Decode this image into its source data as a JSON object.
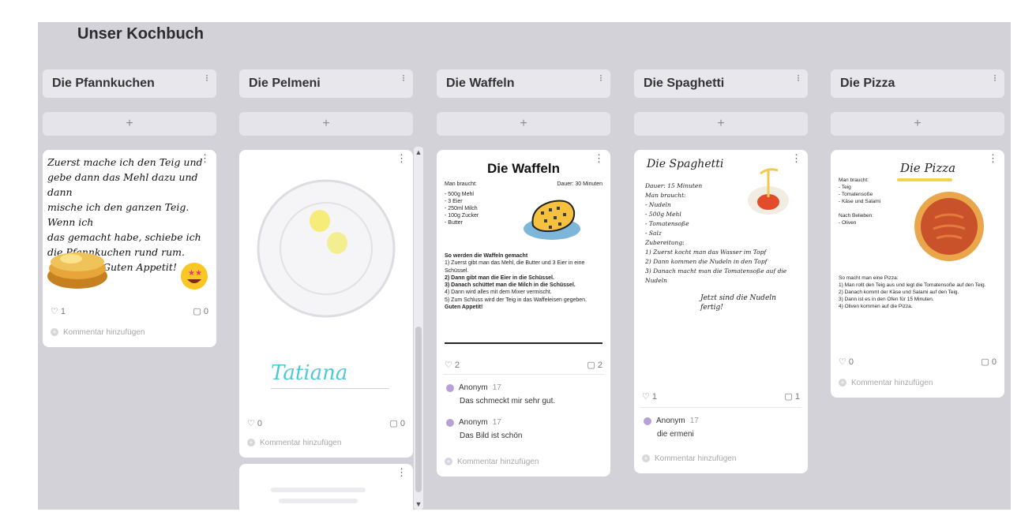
{
  "board": {
    "title": "Unser Kochbuch"
  },
  "columns": [
    {
      "title": "Die Pfannkuchen",
      "add": "+"
    },
    {
      "title": "Die Pelmeni",
      "add": "+"
    },
    {
      "title": "Die Waffeln",
      "add": "+"
    },
    {
      "title": "Die Spaghetti",
      "add": "+"
    },
    {
      "title": "Die Pizza",
      "add": "+"
    }
  ],
  "icons": {
    "menu": "vertical-dots-icon",
    "like": "heart-icon",
    "comment": "speech-bubble-icon",
    "add": "plus-icon"
  },
  "cards": {
    "pfannkuchen": {
      "note_lines": [
        "Zuerst mache ich den Teig und",
        "gebe dann das Mehl dazu und dann",
        "mische ich den ganzen Teig. Wenn ich",
        "das gemacht habe, schiebe ich",
        "die Pfannkuchen rund rum.",
        "Guten Appetit!"
      ],
      "likes": "1",
      "comments": "0",
      "add_comment": "Kommentar hinzufügen"
    },
    "pelmeni": {
      "signature": "Tatiana",
      "likes": "0",
      "comments": "0",
      "add_comment": "Kommentar hinzufügen"
    },
    "waffeln": {
      "title": "Die Waffeln",
      "left_head": "Man braucht:",
      "right_head": "Dauer: 30 Minuten",
      "ingredients": [
        "- 500g Mehl",
        "- 3 Eier",
        "- 250ml Milch",
        "- 100g Zucker",
        "- Butter"
      ],
      "steps_head": "So werden die Waffeln gemacht",
      "steps": [
        "1) Zuerst gibt man das Mehl, die Butter und 3 Eier in eine Schüssel.",
        "2) Dann gibt man die Eier in die Schüssel.",
        "3) Danach schüttet man die Milch in die Schüssel.",
        "4) Dann wird alles mit dem Mixer vermischt.",
        "5) Zum Schluss wird der Teig in das Waffeleisen gegeben.",
        "Guten Appetit!"
      ],
      "likes": "2",
      "comments": "2",
      "comment_list": [
        {
          "author": "Anonym",
          "time": "17",
          "text": "Das schmeckt mir sehr gut."
        },
        {
          "author": "Anonym",
          "time": "17",
          "text": "Das Bild ist schön"
        }
      ],
      "add_comment": "Kommentar hinzufügen"
    },
    "spaghetti": {
      "title": "Die Spaghetti",
      "lines": [
        "Dauer: 15 Minuten",
        "Man braucht:",
        "- Nudeln",
        "- 500g Mehl",
        "- Tomatensoße",
        "- Salz",
        "Zubereitung:",
        "1) Zuerst kocht man das Wasser im Topf",
        "2) Dann kommen die Nudeln in den Topf",
        "3) Danach macht man die Tomatensoße auf die Nudeln",
        "Jetzt sind die Nudeln fertig!"
      ],
      "likes": "1",
      "comments": "1",
      "comment_list": [
        {
          "author": "Anonym",
          "time": "17",
          "text": "die ermeni"
        }
      ],
      "add_comment": "Kommentar hinzufügen"
    },
    "pizza": {
      "title": "Die Pizza",
      "lines": [
        "Man braucht:",
        "- Teig",
        "- Tomatensoße",
        "- Käse und Salami",
        "",
        "Nach Belieben:",
        "- Oliven",
        "",
        "So macht man eine Pizza:",
        "1) Man rollt den Teig aus und legt die Tomatensoße auf den Teig.",
        "2) Danach kommt der Käse und Salami auf den Teig.",
        "3) Dann ist es in den Ofen für 15 Minuten.",
        "4) Oliven kommen auf die Pizza."
      ],
      "likes": "0",
      "comments": "0",
      "add_comment": "Kommentar hinzufügen"
    }
  }
}
